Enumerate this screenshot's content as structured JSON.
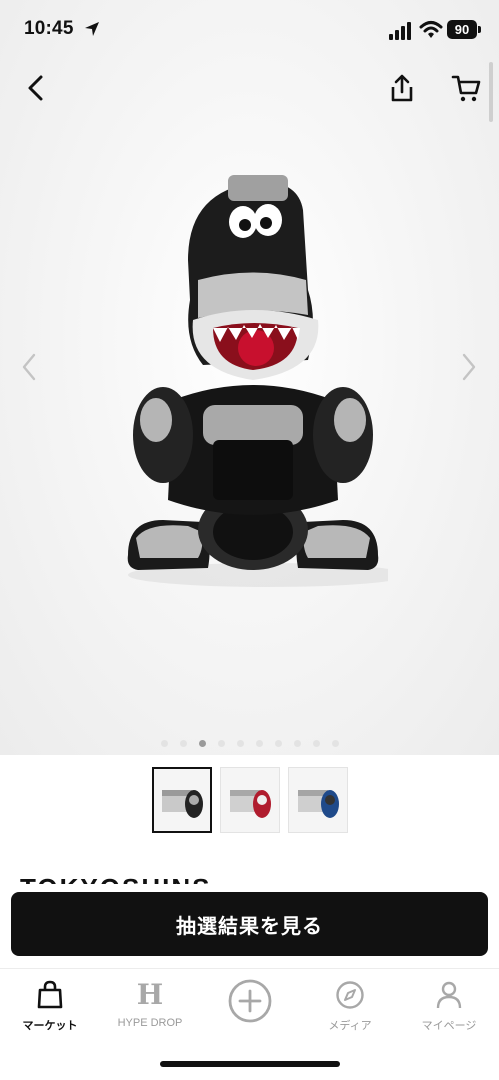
{
  "status_bar": {
    "time": "10:45",
    "battery": "90"
  },
  "top_nav": {
    "back_icon": "chevron-left-icon",
    "share_icon": "share-icon",
    "cart_icon": "cart-icon"
  },
  "gallery": {
    "image_count": 10,
    "active_index": 2,
    "thumbnail_count": 3,
    "selected_thumbnail": 0
  },
  "product": {
    "brand_partial": "TOKYOSHINS"
  },
  "cta": {
    "label": "抽選結果を見る"
  },
  "tabbar": {
    "items": [
      {
        "label": "マーケット",
        "icon": "shopping-bag-icon",
        "active": true
      },
      {
        "label": "HYPE DROP",
        "icon": "hype-h-icon",
        "active": false
      },
      {
        "label": "",
        "icon": "plus-circle-icon",
        "active": false
      },
      {
        "label": "メディア",
        "icon": "compass-icon",
        "active": false
      },
      {
        "label": "マイページ",
        "icon": "person-icon",
        "active": false
      }
    ]
  },
  "colors": {
    "primary": "#111111",
    "muted": "#9a9a9a",
    "accent_red": "#c8102e"
  }
}
